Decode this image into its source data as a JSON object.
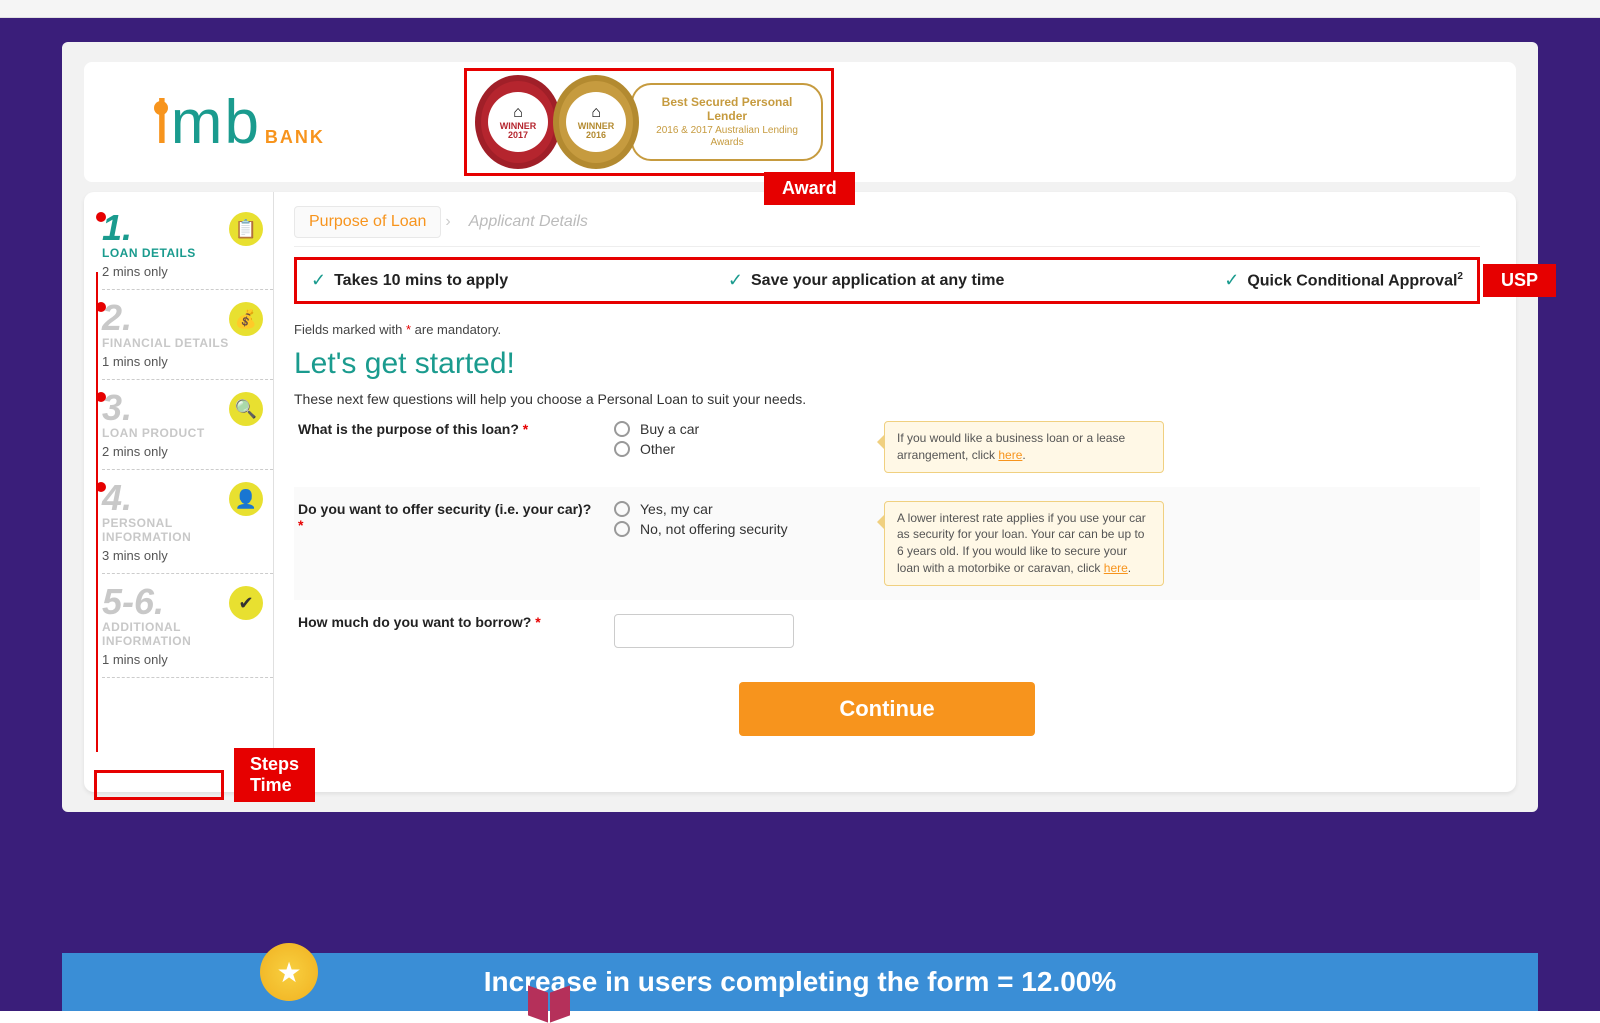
{
  "header": {
    "logo_i": "i",
    "logo_m": "m",
    "logo_b": "b",
    "logo_bank": "BANK",
    "award": {
      "medal1_winner": "WINNER",
      "medal1_year": "2017",
      "medal2_winner": "WINNER",
      "medal2_year": "2016",
      "title": "Best Secured Personal Lender",
      "subtitle": "2016 & 2017 Australian Lending Awards"
    },
    "award_tag": "Award"
  },
  "sidebar": {
    "steps": [
      {
        "num": "1.",
        "label": "LOAN DETAILS",
        "time": "2 mins only"
      },
      {
        "num": "2.",
        "label": "FINANCIAL DETAILS",
        "time": "1 mins only"
      },
      {
        "num": "3.",
        "label": "LOAN PRODUCT",
        "time": "2 mins only"
      },
      {
        "num": "4.",
        "label": "PERSONAL INFORMATION",
        "time": "3 mins only"
      },
      {
        "num": "5-6.",
        "label": "ADDITIONAL INFORMATION",
        "time": "1 mins only"
      }
    ],
    "steps_time_tag": "Steps Time"
  },
  "content": {
    "tabs": {
      "active": "Purpose of Loan",
      "inactive": "Applicant Details"
    },
    "usps": [
      "Takes 10 mins to apply",
      "Save your application at any time",
      "Quick Conditional Approval"
    ],
    "usp_tag": "USP",
    "mandatory": "Fields marked with * are mandatory.",
    "heading": "Let's get started!",
    "subheading": "These next few questions will help you choose a Personal Loan to suit your needs.",
    "q1": {
      "label": "What is the purpose of this loan?",
      "opts": [
        "Buy a car",
        "Other"
      ],
      "tip_pre": "If you would like a business loan or a lease arrangement, click ",
      "tip_link": "here",
      "tip_post": "."
    },
    "q2": {
      "label": "Do you want to offer security (i.e. your car)?",
      "opts": [
        "Yes, my car",
        "No, not offering security"
      ],
      "tip_pre": "A lower interest rate applies if you use your car as security for your loan. Your car can be up to 6 years old. If you would like to secure your loan with a motorbike or caravan, click ",
      "tip_link": "here",
      "tip_post": "."
    },
    "q3": {
      "label": "How much do you want to borrow?"
    },
    "continue": "Continue"
  },
  "banner": {
    "text": "Increase in users completing the form = 12.00%"
  }
}
